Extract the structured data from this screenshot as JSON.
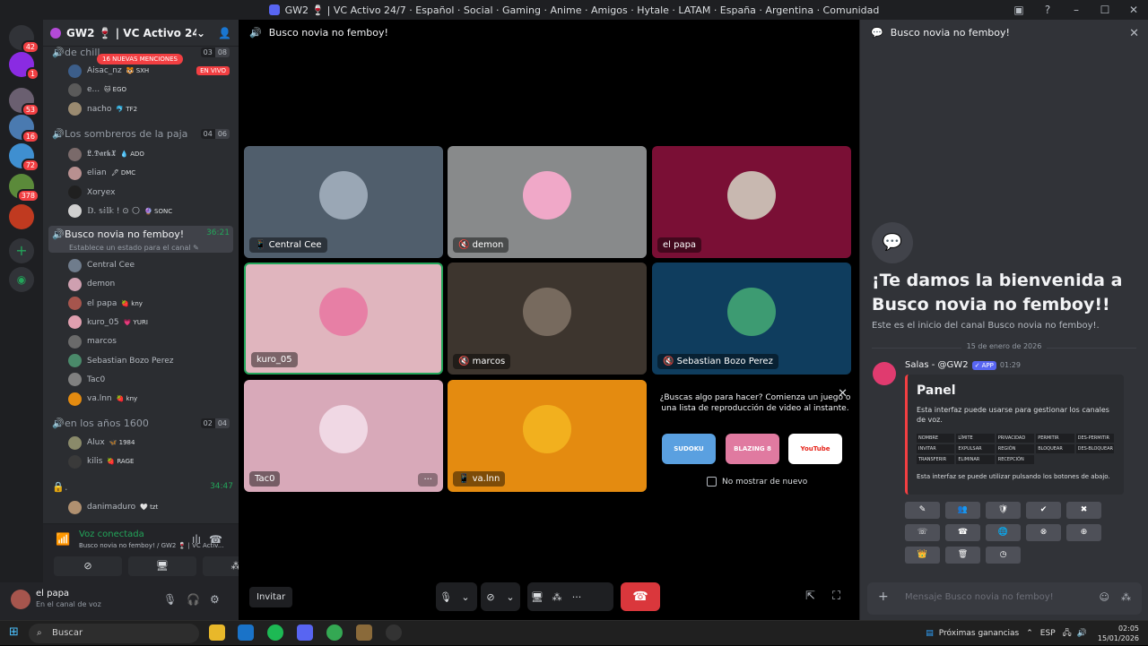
{
  "window": {
    "title": "GW2 🍷 | VC Activo 24/7 · Español · Social · Gaming · Anime · Amigos · Hytale · LATAM · España · Argentina · Comunidad"
  },
  "servers": [
    {
      "badge": "42"
    },
    {
      "badge": "1"
    },
    {
      "badge": "53"
    },
    {
      "badge": "16"
    },
    {
      "badge": "72"
    },
    {
      "badge": "378"
    }
  ],
  "guild": {
    "name": "GW2 🍷 | VC Activo 24/7 · ..."
  },
  "mention_pill": "16 NUEVAS MENCIONES",
  "live_badge": "EN VIVO",
  "channels": {
    "c1": {
      "name": "de chill",
      "a": "03",
      "b": "08"
    },
    "c2": {
      "name": "Los sombreros de la paja",
      "a": "04",
      "b": "06"
    },
    "c3": {
      "name": "Busco novia no femboy!",
      "time": "36:21",
      "status": "Establece un estado para el canal ✎"
    },
    "c4": {
      "name": "en los años 1600",
      "a": "02",
      "b": "04"
    },
    "c5": {
      "name": ".",
      "time": "34:47"
    }
  },
  "members_c1": [
    {
      "name": "Aisac_nz",
      "tag": "🐯 SXH",
      "color": "#3c5e8a"
    },
    {
      "name": "e...",
      "tag": "🐱 EGO",
      "color": "#5a5a5a"
    },
    {
      "name": "nacho",
      "tag": "🐬 TF2",
      "color": "#9a8a70"
    }
  ],
  "members_c2": [
    {
      "name": "𝕷.𝕯𝖆𝖗𝖐𝖃",
      "tag": "💧 ADO",
      "color": "#7a6a6a"
    },
    {
      "name": "elian",
      "tag": "🖋 DMC",
      "color": "#b89090"
    },
    {
      "name": "Xoryex",
      "tag": "",
      "color": "#202020"
    },
    {
      "name": "𝔻. 𝕤𝕚𝕝𝕜 ! ⊙ 🌕",
      "tag": "🔮 SONC",
      "color": "#d0d0d0"
    }
  ],
  "members_c3": [
    {
      "name": "Central Cee",
      "tag": "",
      "color": "#6f7c8c"
    },
    {
      "name": "demon",
      "tag": "",
      "color": "#cfa0b0"
    },
    {
      "name": "el papa",
      "tag": "🍓 kny",
      "color": "#a6554d"
    },
    {
      "name": "kuro_05",
      "tag": "💗 YURI",
      "color": "#e0a0b0"
    },
    {
      "name": "marcos",
      "tag": "",
      "color": "#6a6a6a"
    },
    {
      "name": "Sebastian Bozo Perez",
      "tag": "",
      "color": "#4a8a6a"
    },
    {
      "name": "Tac0",
      "tag": "",
      "color": "#808080"
    },
    {
      "name": "va.lnn",
      "tag": "🍓 kny",
      "color": "#e48b10"
    }
  ],
  "members_c4": [
    {
      "name": "Alux",
      "tag": "🦋 1984",
      "color": "#8a8a6a"
    },
    {
      "name": "kilis",
      "tag": "🍓 RAGE",
      "color": "#3a3a3a"
    }
  ],
  "members_c5": [
    {
      "name": "danimaduro",
      "tag": "🤍 tzt",
      "color": "#b09070"
    }
  ],
  "voice": {
    "status": "Voz conectada",
    "channel": "Busco novia no femboy! / GW2 🍷 | VC Activ..."
  },
  "user": {
    "name": "el papa",
    "status": "En el canal de voz"
  },
  "stage": {
    "header": "Busco novia no femboy!",
    "tiles": [
      {
        "label": "Central Cee",
        "prefix": "📱 ",
        "bg": "#505e6c",
        "av": "#9aa7b5"
      },
      {
        "label": "demon",
        "prefix": "🔇 ",
        "bg": "#888a8b",
        "av": "#f0a8c8"
      },
      {
        "label": "el papa",
        "prefix": "",
        "bg": "#7a0f35",
        "av": "#c8b8b0"
      },
      {
        "label": "kuro_05",
        "prefix": "",
        "bg": "#e0b5be",
        "av": "#e77fa5"
      },
      {
        "label": "marcos",
        "prefix": "🔇 ",
        "bg": "#3d352e",
        "av": "#776a5e"
      },
      {
        "label": "Sebastian Bozo Perez",
        "prefix": "🔇 ",
        "bg": "#0f3d5e",
        "av": "#3d9b72"
      },
      {
        "label": "Tac0",
        "prefix": "",
        "bg": "#d8a9b9",
        "av": "#f0d8e4"
      },
      {
        "label": "va.lnn",
        "prefix": "📱 ",
        "bg": "#e48b10",
        "av": "#f2b01e"
      }
    ],
    "activity": {
      "title": "¿Buscas algo para hacer? Comienza un juego o una lista de reproducción de video al instante.",
      "checkbox": "No mostrar de nuevo",
      "cards": [
        {
          "label": "SUDOKU",
          "bg": "#5aa0e0"
        },
        {
          "label": "BLAZING 8",
          "bg": "#e07aa0"
        },
        {
          "label": "YouTube",
          "bg": "#ffffff"
        }
      ]
    },
    "invite": "Invitar"
  },
  "chat": {
    "header": "Busco novia no femboy!",
    "welcome_title": "¡Te damos la bienvenida a Busco novia no femboy!!",
    "welcome_sub": "Este es el inicio del canal Busco novia no femboy!.",
    "date": "15 de enero de 2026",
    "author": "Salas - @GW2",
    "app": "✓ APP",
    "time": "01:29",
    "embed_title": "Panel",
    "embed_desc": "Esta interfaz puede usarse para gestionar los canales de voz.",
    "embed_items": [
      "NOMBRE",
      "LÍMITE",
      "PRIVACIDAD",
      "PERMITIR",
      "DES-PERMITIR",
      "INVITAR",
      "EXPULSAR",
      "REGIÓN",
      "BLOQUEAR",
      "DES-BLOQUEAR",
      "TRANSFERIR",
      "ELIMINAR",
      "RECEPCIÓN"
    ],
    "embed_foot": "Esta interfaz se puede utilizar pulsando los botones de abajo.",
    "input_placeholder": "Mensaje Busco novia no femboy!"
  },
  "taskbar": {
    "search": "Buscar",
    "widget": "Próximas ganancias",
    "lang": "ESP",
    "time": "02:05",
    "date": "15/01/2026"
  }
}
